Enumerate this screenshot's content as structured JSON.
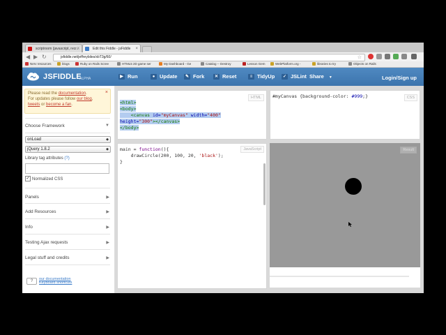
{
  "browser": {
    "tabs": [
      {
        "label": "scriptroom (javascript, recr...",
        "close": "×",
        "color": "#cc1111",
        "active": false
      },
      {
        "label": "Edit this Fiddle - jsFiddle",
        "close": "×",
        "color": "#3a7bc8",
        "active": true
      }
    ],
    "url": "jsfiddle.net/jeffreybiles/xbT3g/60/",
    "bookmarks": [
      {
        "label": "Nerv resources",
        "color": "#c33"
      },
      {
        "label": "blogs",
        "color": "#c9a227"
      },
      {
        "label": "Ruby on Rails Scree",
        "color": "#c33"
      },
      {
        "label": "HTML5 2D game ser",
        "color": "#888"
      },
      {
        "label": "My Dashboard - Ge",
        "color": "#e67e22"
      },
      {
        "label": "Catalog -- Destroy",
        "color": "#888"
      },
      {
        "label": "Lesson Gem",
        "color": "#b22"
      },
      {
        "label": "WebPlatform.org -",
        "color": "#c9a227"
      },
      {
        "label": "libraries to try",
        "color": "#c9a227"
      },
      {
        "label": "Objects on Rails",
        "color": "#888"
      }
    ]
  },
  "header": {
    "logo": "JSFIDDLE",
    "logo_sub": "ALPHA",
    "buttons": [
      {
        "label": "Run",
        "icon": "play-icon"
      },
      {
        "label": "Update",
        "icon": "update-icon"
      },
      {
        "label": "Fork",
        "icon": "fork-icon"
      },
      {
        "label": "Reset",
        "icon": "reset-icon"
      },
      {
        "label": "TidyUp",
        "icon": "tidy-icon"
      },
      {
        "label": "JSLint",
        "icon": "check-icon"
      },
      {
        "label": "Share",
        "icon": "share-icon"
      }
    ],
    "login": "Login/Sign up"
  },
  "sidebar": {
    "notice": {
      "line1_a": "Please read the ",
      "line1_link": "documentation",
      "line1_b": ".",
      "line2_a": "For updates please follow ",
      "line2_link": "our blog",
      "line2_b": ",",
      "line3_link1": "tweets",
      "line3_a": " or ",
      "line3_link2": "become a fan",
      "line3_b": ".",
      "close": "×"
    },
    "framework_title": "Choose Framework",
    "onload_select": "onLoad",
    "library_select": "jQuery 1.8.2",
    "library_tag_label": "Library tag attributes",
    "library_tag_help": "(?)",
    "normalized_label": "Normalized CSS",
    "normalized_checked": "✓",
    "sections": [
      "Panels",
      "Add Resources",
      "Info",
      "Testing Ajax requests",
      "Legal stuff and credits"
    ],
    "keyboard_key": "?",
    "keyboard_text1": "our documentation",
    "keyboard_text2": "Keyboard shortcuts"
  },
  "panels": {
    "html_label": "HTML",
    "css_label": "CSS",
    "js_label": "JavaScript",
    "result_label": "Result",
    "html_code": {
      "l1": "<html>",
      "l2": "<body>",
      "l3_tag": "<canvas",
      "l3_attr1": " id=",
      "l3_val1": "\"myCanvas\"",
      "l3_attr2": " width=",
      "l3_val2": "\"400\"",
      "l4_attr": "height=",
      "l4_val": "\"300\"",
      "l4_tag": "></canvas>",
      "l5": "</body>"
    },
    "css_code": {
      "selector": "#myCanvas ",
      "rule": "{background-color: ",
      "value": "#999",
      "end": ";}"
    },
    "js_code": {
      "l1_a": "main = ",
      "l1_kw": "function",
      "l1_b": "(){",
      "l2_a": "    drawCircle(200, 100, 20, ",
      "l2_str": "'black'",
      "l2_b": ");",
      "l3": "}"
    },
    "result_bg": "#999999"
  },
  "colors": {
    "accent": "#4580bd",
    "notice_bg": "#fff6d9"
  }
}
